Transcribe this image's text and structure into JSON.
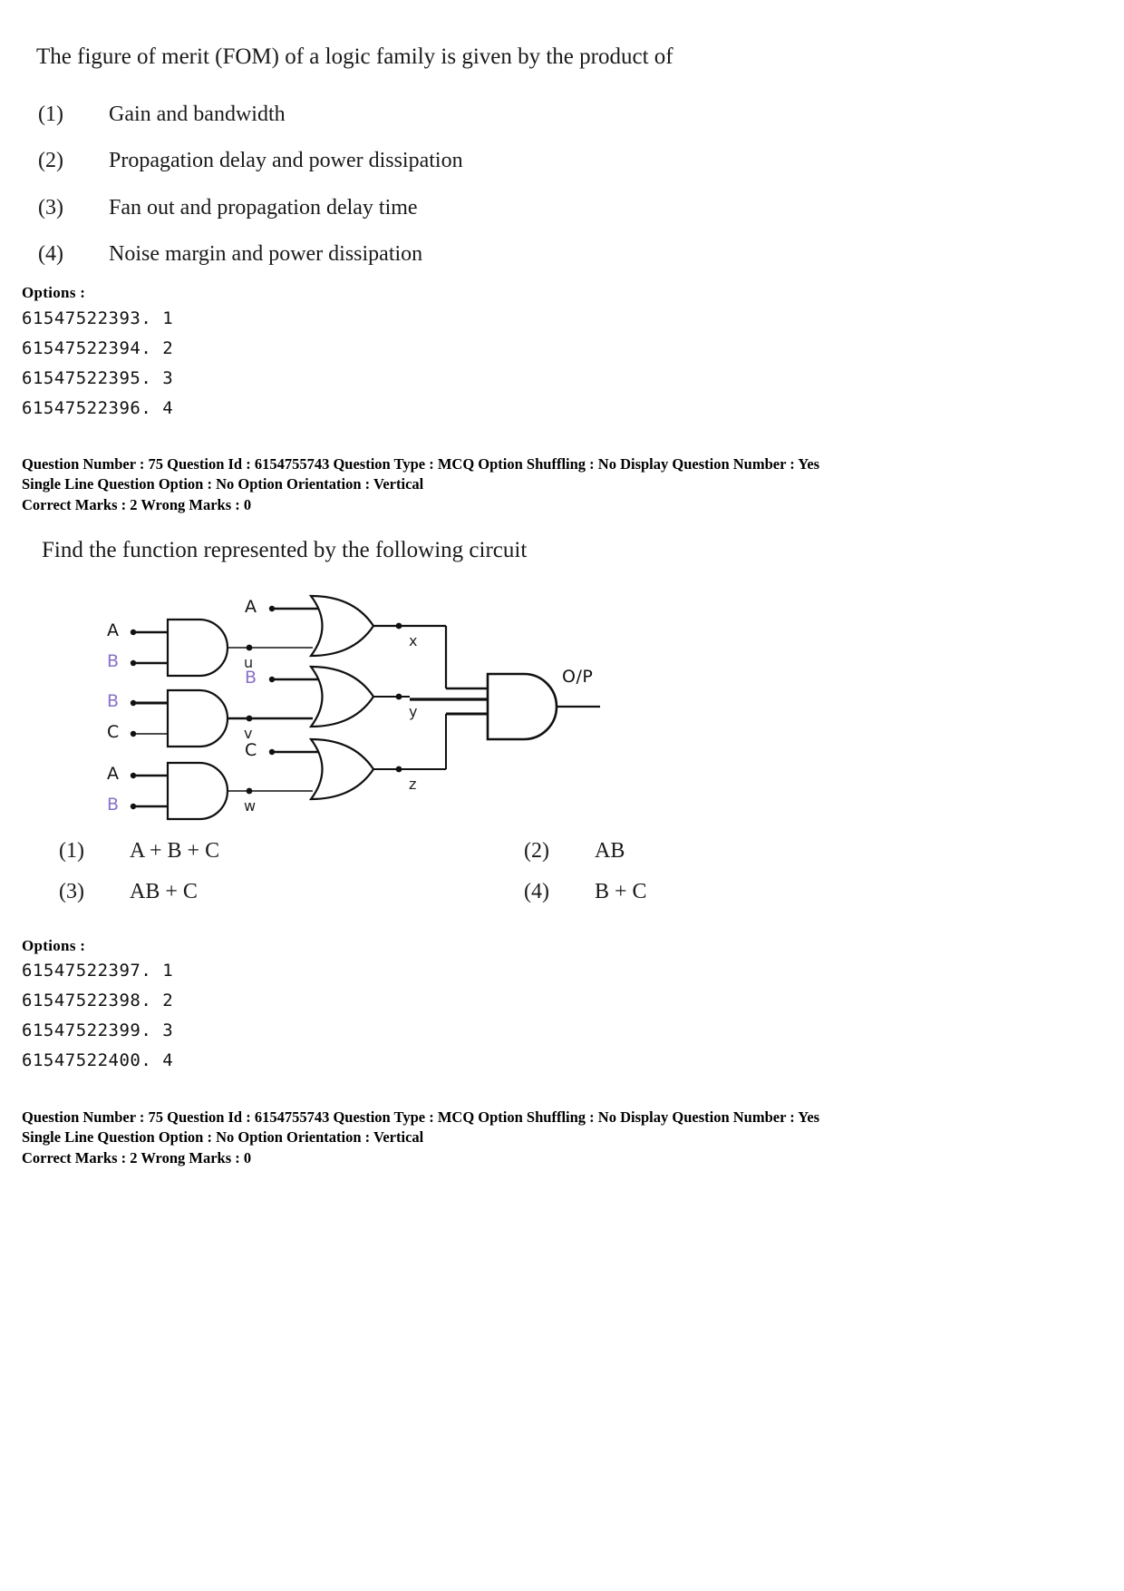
{
  "question1": {
    "stem": "The figure of merit (FOM) of a logic family is given by the product of",
    "choices": [
      {
        "num": "(1)",
        "text": "Gain and bandwidth"
      },
      {
        "num": "(2)",
        "text": "Propagation delay and power dissipation"
      },
      {
        "num": "(3)",
        "text": "Fan out and propagation delay time"
      },
      {
        "num": "(4)",
        "text": "Noise margin and power dissipation"
      }
    ],
    "options_label": "Options :",
    "option_ids": [
      "61547522393. 1",
      "61547522394. 2",
      "61547522395. 3",
      "61547522396. 4"
    ],
    "meta": {
      "line1": "Question Number : 75  Question Id : 6154755743  Question Type : MCQ  Option Shuffling : No  Display Question Number : Yes",
      "line2": "Single Line Question Option : No  Option Orientation : Vertical",
      "line3": "Correct Marks : 2  Wrong Marks : 0"
    }
  },
  "question2": {
    "stem": "Find the function represented by the following circuit",
    "circuit": {
      "rows": [
        {
          "and_inputs": [
            "A",
            "B"
          ],
          "and_output_node": "u",
          "or_extra_input": "A",
          "or_output_node": "x"
        },
        {
          "and_inputs": [
            "B",
            "C"
          ],
          "and_output_node": "v",
          "or_extra_input": "B",
          "or_output_node": "y"
        },
        {
          "and_inputs": [
            "A",
            "B"
          ],
          "and_output_node": "w",
          "or_extra_input": "C",
          "or_output_node": "z"
        }
      ],
      "output_label": "O/P",
      "violet_labels": [
        "B",
        "B",
        "B",
        "B"
      ],
      "accent_color": "#8a70c8",
      "line_color": "#111111"
    },
    "choices": [
      {
        "num": "(1)",
        "text": "A + B + C"
      },
      {
        "num": "(2)",
        "text": "AB"
      },
      {
        "num": "(3)",
        "text": "AB + C"
      },
      {
        "num": "(4)",
        "text": "B + C"
      }
    ],
    "options_label": "Options :",
    "option_ids": [
      "61547522397. 1",
      "61547522398. 2",
      "61547522399. 3",
      "61547522400. 4"
    ],
    "meta": {
      "line1": "Question Number : 75  Question Id : 6154755743  Question Type : MCQ  Option Shuffling : No  Display Question Number : Yes",
      "line2": "Single Line Question Option : No  Option Orientation : Vertical",
      "line3": "Correct Marks : 2  Wrong Marks : 0"
    }
  }
}
